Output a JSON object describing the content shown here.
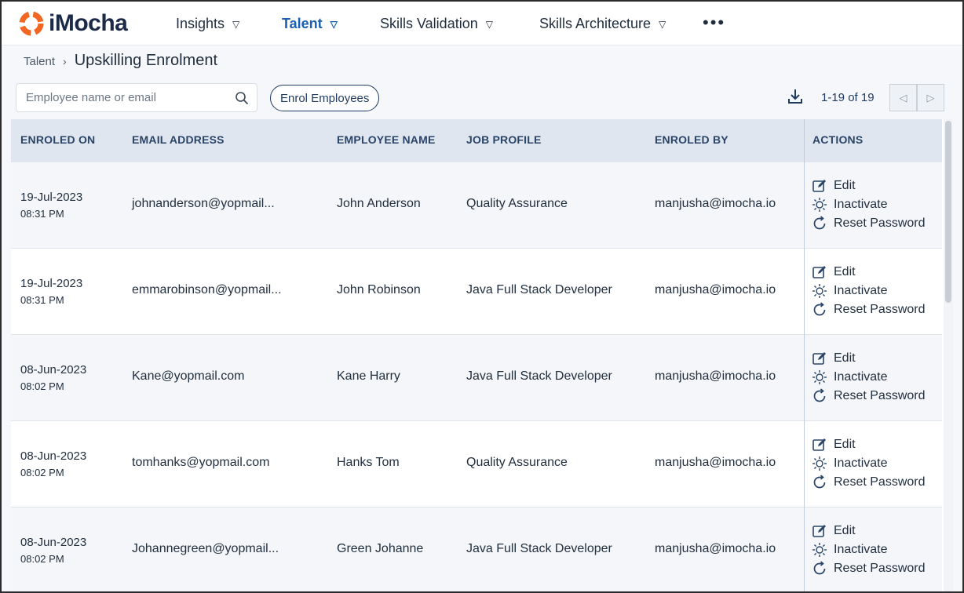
{
  "brand": {
    "name": "iMocha"
  },
  "nav": {
    "items": [
      {
        "label": "Insights",
        "active": false
      },
      {
        "label": "Talent",
        "active": true
      },
      {
        "label": "Skills Validation",
        "active": false
      },
      {
        "label": "Skills Architecture",
        "active": false
      }
    ],
    "more": "•••"
  },
  "breadcrumb": {
    "parent": "Talent",
    "separator": "›",
    "current": "Upskilling Enrolment"
  },
  "toolbar": {
    "search_placeholder": "Employee name or email",
    "search_value": "",
    "enrol_label": "Enrol Employees",
    "pager_text": "1-19 of 19",
    "prev_glyph": "◁",
    "next_glyph": "▷"
  },
  "table": {
    "columns": [
      "ENROLED ON",
      "EMAIL ADDRESS",
      "EMPLOYEE NAME",
      "JOB PROFILE",
      "ENROLED BY",
      "ACTIONS"
    ],
    "action_labels": {
      "edit": "Edit",
      "inactivate": "Inactivate",
      "reset": "Reset Password"
    },
    "rows": [
      {
        "date": "19-Jul-2023",
        "time": "08:31 PM",
        "email": "johnanderson@yopmail...",
        "name": "John Anderson",
        "profile": "Quality Assurance",
        "enroled_by": "manjusha@imocha.io"
      },
      {
        "date": "19-Jul-2023",
        "time": "08:31 PM",
        "email": "emmarobinson@yopmail...",
        "name": "John Robinson",
        "profile": "Java Full Stack Developer",
        "enroled_by": "manjusha@imocha.io"
      },
      {
        "date": "08-Jun-2023",
        "time": "08:02 PM",
        "email": "Kane@yopmail.com",
        "name": "Kane Harry",
        "profile": "Java Full Stack Developer",
        "enroled_by": "manjusha@imocha.io"
      },
      {
        "date": "08-Jun-2023",
        "time": "08:02 PM",
        "email": "tomhanks@yopmail.com",
        "name": "Hanks Tom",
        "profile": "Quality Assurance",
        "enroled_by": "manjusha@imocha.io"
      },
      {
        "date": "08-Jun-2023",
        "time": "08:02 PM",
        "email": "Johannegreen@yopmail...",
        "name": "Green Johanne",
        "profile": "Java Full Stack Developer",
        "enroled_by": "manjusha@imocha.io"
      }
    ]
  },
  "colors": {
    "accent": "#1a5fb4",
    "logo": "#f26522",
    "header_bg": "#dfe6ef",
    "header_text": "#2a4468"
  }
}
